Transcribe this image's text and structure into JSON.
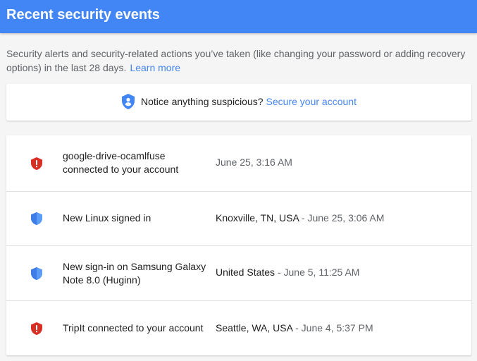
{
  "header": {
    "title": "Recent security events"
  },
  "intro": {
    "text": "Security alerts and security-related actions you’ve taken (like changing your password or adding recovery options) in the last 28 days.",
    "link": "Learn more"
  },
  "notice": {
    "icon": "shield-person-icon",
    "text": "Notice anything suspicious?",
    "link": "Secure your account"
  },
  "colors": {
    "header": "#4285f4",
    "link": "#4285f4",
    "alert_red": "#d93025",
    "info_blue": "#4285f4"
  },
  "events": [
    {
      "icon": "red-alert-shield-icon",
      "severity": "alert",
      "title": "google-drive-ocamlfuse connected to your account",
      "location": "",
      "separator": "",
      "time": "June 25, 3:16 AM"
    },
    {
      "icon": "blue-shield-icon",
      "severity": "info",
      "title": "New Linux signed in",
      "location": "Knoxville, TN, USA",
      "separator": " - ",
      "time": "June 25, 3:06 AM"
    },
    {
      "icon": "blue-shield-icon",
      "severity": "info",
      "title": "New sign-in on Samsung Galaxy Note 8.0 (Huginn)",
      "location": "United States",
      "separator": " - ",
      "time": "June 5, 11:25 AM"
    },
    {
      "icon": "red-alert-shield-icon",
      "severity": "alert",
      "title": "TripIt connected to your account",
      "location": "Seattle, WA, USA",
      "separator": " - ",
      "time": "June 4, 5:37 PM"
    }
  ]
}
